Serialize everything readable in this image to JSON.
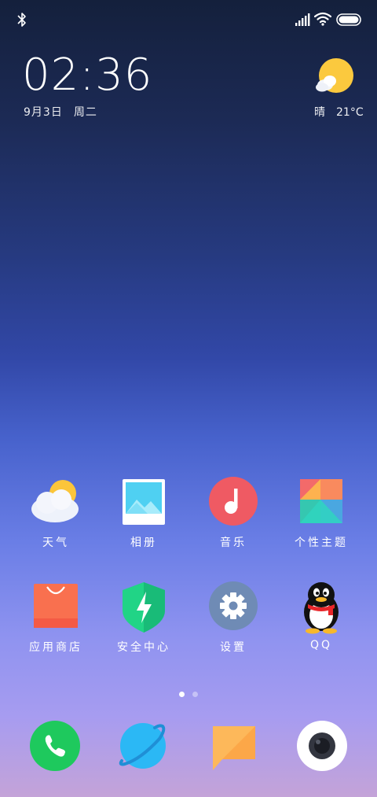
{
  "status_bar": {
    "icons": [
      "bluetooth-icon",
      "signal-icon",
      "wifi-icon",
      "battery-icon"
    ]
  },
  "clock": {
    "time": "02:36",
    "date": "9月3日",
    "weekday": "周二"
  },
  "weather": {
    "icon": "partly-sunny-icon",
    "condition": "晴",
    "temperature": "21°C"
  },
  "apps": [
    {
      "label": "天气",
      "icon": "weather-app-icon"
    },
    {
      "label": "相册",
      "icon": "gallery-app-icon"
    },
    {
      "label": "音乐",
      "icon": "music-app-icon"
    },
    {
      "label": "个性主题",
      "icon": "themes-app-icon"
    },
    {
      "label": "应用商店",
      "icon": "app-store-icon"
    },
    {
      "label": "安全中心",
      "icon": "security-app-icon"
    },
    {
      "label": "设置",
      "icon": "settings-app-icon"
    },
    {
      "label": "QQ",
      "icon": "qq-app-icon"
    }
  ],
  "pager": {
    "total": 2,
    "active": 1
  },
  "dock": [
    {
      "icon": "phone-app-icon"
    },
    {
      "icon": "browser-app-icon"
    },
    {
      "icon": "messages-app-icon"
    },
    {
      "icon": "camera-app-icon"
    }
  ],
  "colors": {
    "phone": "#1ec95d",
    "browser": "#2bb8f5",
    "messages": "#fdb85a",
    "music": "#ef5a63",
    "security": "#21d486",
    "settings": "#6f8bb5",
    "store": "#f9704f"
  }
}
